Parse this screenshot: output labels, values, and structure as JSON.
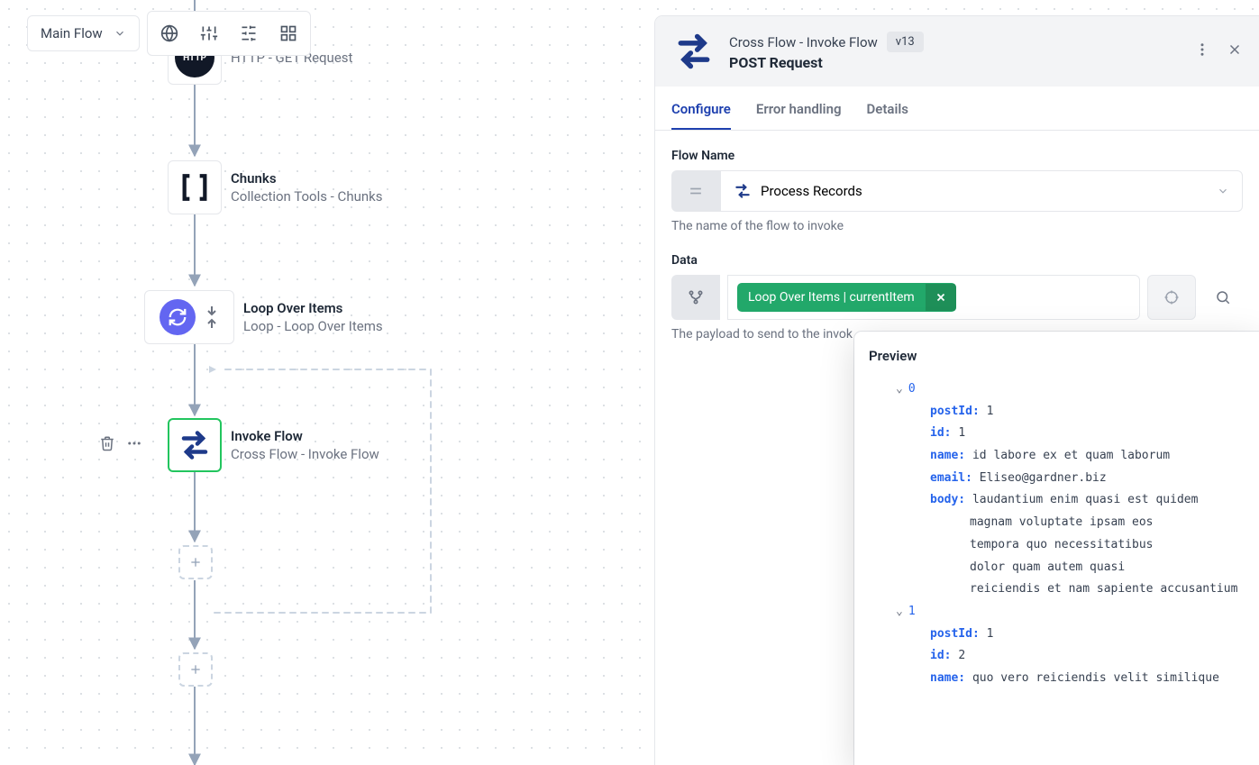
{
  "toolbar": {
    "flow_selector_label": "Main Flow"
  },
  "canvas": {
    "nodes": {
      "http": {
        "subtitle": "HTTP - GET Request"
      },
      "chunks": {
        "title": "Chunks",
        "subtitle": "Collection Tools - Chunks"
      },
      "loop": {
        "title": "Loop Over Items",
        "subtitle": "Loop - Loop Over Items"
      },
      "invoke": {
        "title": "Invoke Flow",
        "subtitle": "Cross Flow - Invoke Flow"
      }
    }
  },
  "panel": {
    "header": {
      "title": "Cross Flow - Invoke Flow",
      "subtitle": "POST Request",
      "version": "v13"
    },
    "tabs": {
      "configure": "Configure",
      "error": "Error handling",
      "details": "Details"
    },
    "fields": {
      "flowName": {
        "label": "Flow Name",
        "value": "Process Records",
        "help": "The name of the flow to invoke"
      },
      "data": {
        "label": "Data",
        "chip": "Loop Over Items | currentItem",
        "help": "The payload to send to the invok"
      }
    }
  },
  "preview": {
    "title": "Preview",
    "items": [
      {
        "index": "0",
        "postId": "1",
        "id": "1",
        "name": "id labore ex et quam laborum",
        "email": "Eliseo@gardner.biz",
        "body": "laudantium enim quasi est quidem magnam voluptate ipsam eos tempora quo necessitatibus dolor quam autem quasi reiciendis et nam sapiente accusantium"
      },
      {
        "index": "1",
        "postId": "1",
        "id": "2",
        "name": "quo vero reiciendis velit similique"
      }
    ]
  }
}
